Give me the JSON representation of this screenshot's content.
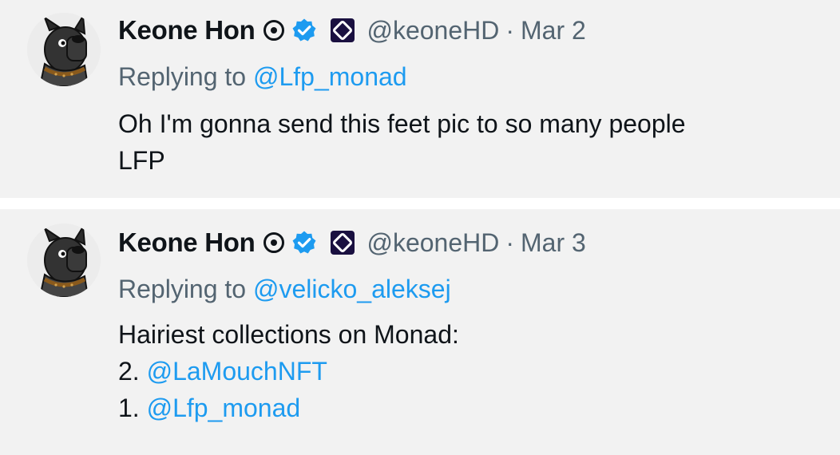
{
  "tweets": [
    {
      "author": "Keone Hon",
      "handle": "@keoneHD",
      "separator": "·",
      "date": "Mar 2",
      "replying_prefix": "Replying to",
      "replying_to": "@Lfp_monad",
      "body_lines": [
        "Oh I'm gonna send this feet pic to so many people",
        "LFP"
      ]
    },
    {
      "author": "Keone Hon",
      "handle": "@keoneHD",
      "separator": "·",
      "date": "Mar 3",
      "replying_prefix": "Replying to",
      "replying_to": "@velicko_aleksej",
      "body_line1": "Hairiest collections on Monad:",
      "list": [
        {
          "num": "2.",
          "mention": "@LaMouchNFT"
        },
        {
          "num": "1.",
          "mention": "@Lfp_monad"
        }
      ]
    }
  ],
  "icons": {
    "avatar": "dog-avatar-icon",
    "target": "target-icon",
    "verified": "verified-badge-icon",
    "affiliate": "monad-affiliate-icon"
  },
  "colors": {
    "background": "#f2f2f2",
    "text": "#0f1419",
    "muted": "#536471",
    "link": "#1d9bf0",
    "verified": "#1d9bf0",
    "affiliate": "#1a1040"
  }
}
